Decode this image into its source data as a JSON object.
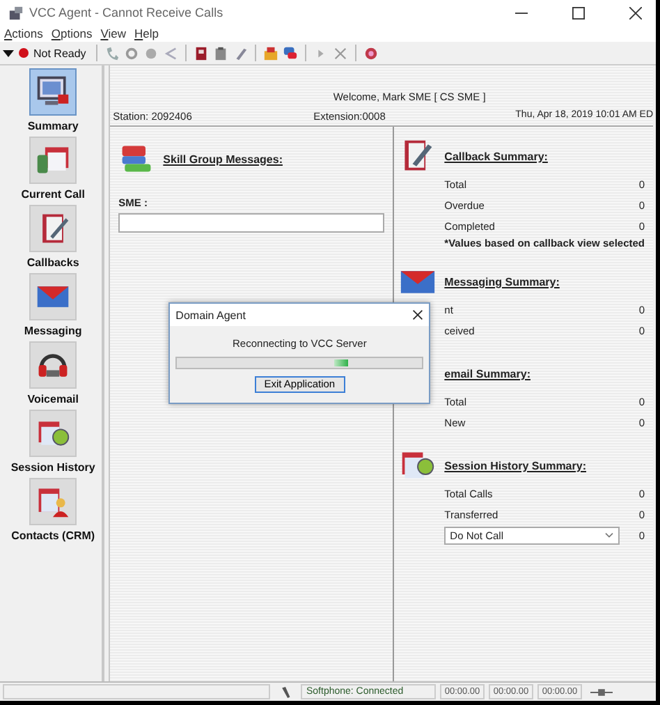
{
  "window": {
    "title": "VCC Agent - Cannot Receive Calls"
  },
  "menu": [
    "Actions",
    "Options",
    "View",
    "Help"
  ],
  "toolbar": {
    "status": "Not Ready"
  },
  "sidebar": {
    "items": [
      {
        "label": "Summary",
        "selected": true
      },
      {
        "label": "Current Call",
        "selected": false
      },
      {
        "label": "Callbacks",
        "selected": false
      },
      {
        "label": "Messaging",
        "selected": false
      },
      {
        "label": "Voicemail",
        "selected": false
      },
      {
        "label": "Session History",
        "selected": false
      },
      {
        "label": "Contacts (CRM)",
        "selected": false
      }
    ]
  },
  "header": {
    "welcome": "Welcome, Mark SME [ CS SME ]",
    "station": "Station: 2092406",
    "extension": "Extension:0008",
    "datetime": "Thu, Apr 18, 2019 10:01 AM ED"
  },
  "skill_group": {
    "title": "Skill Group Messages:",
    "field_label": "SME :"
  },
  "callback_summary": {
    "title": "Callback Summary:",
    "rows": [
      {
        "label": "Total",
        "value": "0"
      },
      {
        "label": "Overdue",
        "value": "0"
      },
      {
        "label": "Completed",
        "value": "0"
      }
    ],
    "note": "*Values based on callback view selected"
  },
  "messaging_summary": {
    "title": "Messaging Summary:",
    "rows": [
      {
        "label": "nt",
        "value": "0"
      },
      {
        "label": "ceived",
        "value": "0"
      }
    ]
  },
  "voicemail_summary": {
    "title": "email Summary:",
    "rows": [
      {
        "label": "Total",
        "value": "0"
      },
      {
        "label": "New",
        "value": "0"
      }
    ]
  },
  "session_history_summary": {
    "title": "Session History Summary:",
    "rows": [
      {
        "label": "Total Calls",
        "value": "0"
      },
      {
        "label": "Transferred",
        "value": "0"
      }
    ],
    "dropdown": {
      "value": "Do Not Call",
      "count": "0"
    }
  },
  "dialog": {
    "title": "Domain Agent",
    "message": "Reconnecting to VCC Server",
    "progress": {
      "level": 0.7
    },
    "button": "Exit Application"
  },
  "status_bar": {
    "softphone": "Softphone: Connected",
    "timers": [
      "00:00.00",
      "00:00.00",
      "00:00.00"
    ]
  }
}
